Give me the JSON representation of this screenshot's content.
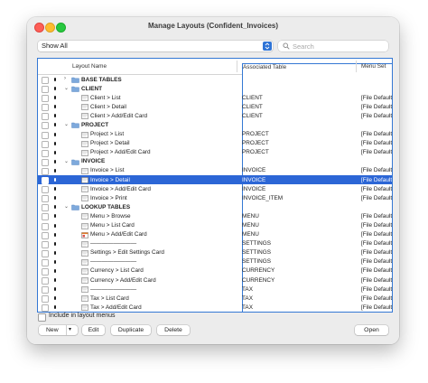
{
  "window": {
    "title": "Manage Layouts (Confident_Invoices)"
  },
  "toolbar": {
    "show_value": "Show All",
    "search_placeholder": "Search"
  },
  "columns": {
    "name": "Layout Name",
    "table": "Associated Table",
    "menu": "Menu Set"
  },
  "rows": [
    {
      "kind": "group",
      "expanded": false,
      "name": "BASE TABLES"
    },
    {
      "kind": "group",
      "expanded": true,
      "name": "CLIENT"
    },
    {
      "kind": "layout",
      "icon": "layout-icon",
      "name": "Client > List",
      "table": "CLIENT",
      "menu": "[File Default]"
    },
    {
      "kind": "layout",
      "icon": "layout-icon",
      "name": "Client > Detail",
      "table": "CLIENT",
      "menu": "[File Default]"
    },
    {
      "kind": "layout",
      "icon": "layout-icon",
      "name": "Client > Add/Edit Card",
      "table": "CLIENT",
      "menu": "[File Default]"
    },
    {
      "kind": "group",
      "expanded": true,
      "name": "PROJECT"
    },
    {
      "kind": "layout",
      "icon": "layout-icon",
      "name": "Project > List",
      "table": "PROJECT",
      "menu": "[File Default]"
    },
    {
      "kind": "layout",
      "icon": "layout-icon",
      "name": "Project > Detail",
      "table": "PROJECT",
      "menu": "[File Default]"
    },
    {
      "kind": "layout",
      "icon": "layout-icon",
      "name": "Project > Add/Edit Card",
      "table": "PROJECT",
      "menu": "[File Default]"
    },
    {
      "kind": "group",
      "expanded": true,
      "name": "INVOICE"
    },
    {
      "kind": "layout",
      "icon": "layout-icon",
      "name": "Invoice > List",
      "table": "INVOICE",
      "menu": "[File Default]"
    },
    {
      "kind": "layout",
      "icon": "layout-icon",
      "name": "Invoice > Detail",
      "table": "INVOICE",
      "menu": "[File Default]",
      "selected": true
    },
    {
      "kind": "layout",
      "icon": "layout-icon",
      "name": "Invoice > Add/Edit Card",
      "table": "INVOICE",
      "menu": "[File Default]"
    },
    {
      "kind": "layout",
      "icon": "layout-icon",
      "name": "Invoice > Print",
      "table": "INVOICE_ITEM",
      "menu": "[File Default]"
    },
    {
      "kind": "group",
      "expanded": true,
      "name": "LOOKUP TABLES"
    },
    {
      "kind": "layout",
      "icon": "layout-icon",
      "name": "Menu > Browse",
      "table": "MENU",
      "menu": "[File Default]"
    },
    {
      "kind": "layout",
      "icon": "layout-icon",
      "name": "Menu > List Card",
      "table": "MENU",
      "menu": "[File Default]"
    },
    {
      "kind": "layout",
      "icon": "color-layout-icon",
      "name": "Menu > Add/Edit Card",
      "table": "MENU",
      "menu": "[File Default]"
    },
    {
      "kind": "layout",
      "icon": "layout-icon",
      "name": "————————",
      "table": "SETTINGS",
      "menu": "[File Default]"
    },
    {
      "kind": "layout",
      "icon": "layout-icon",
      "name": "Settings > Edit Settings Card",
      "table": "SETTINGS",
      "menu": "[File Default]"
    },
    {
      "kind": "layout",
      "icon": "layout-icon",
      "name": "————————",
      "table": "SETTINGS",
      "menu": "[File Default]"
    },
    {
      "kind": "layout",
      "icon": "layout-icon",
      "name": "Currency > List Card",
      "table": "CURRENCY",
      "menu": "[File Default]"
    },
    {
      "kind": "layout",
      "icon": "layout-icon",
      "name": "Currency > Add/Edit Card",
      "table": "CURRENCY",
      "menu": "[File Default]"
    },
    {
      "kind": "layout",
      "icon": "layout-icon",
      "name": "————————",
      "table": "TAX",
      "menu": "[File Default]"
    },
    {
      "kind": "layout",
      "icon": "layout-icon",
      "name": "Tax > List Card",
      "table": "TAX",
      "menu": "[File Default]"
    },
    {
      "kind": "layout",
      "icon": "layout-icon",
      "name": "Tax > Add/Edit Card",
      "table": "TAX",
      "menu": "[File Default]"
    }
  ],
  "footer": {
    "include_label": "Include in layout menus",
    "new_label": "New",
    "edit_label": "Edit",
    "duplicate_label": "Duplicate",
    "delete_label": "Delete",
    "open_label": "Open"
  },
  "colors": {
    "accent": "#2c66d6",
    "folder": "#7ea9dc",
    "window_bg": "#ececec"
  }
}
